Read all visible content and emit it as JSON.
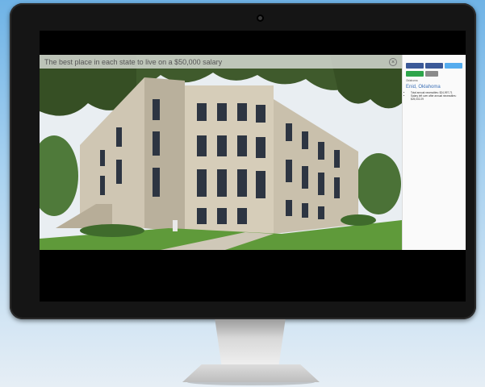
{
  "article": {
    "caption": "The best place in each state to live on a $50,000 salary",
    "close_symbol": "×"
  },
  "sidebar": {
    "share_buttons": [
      {
        "name": "share",
        "color": "#3b5998"
      },
      {
        "name": "share",
        "color": "#3b5998"
      },
      {
        "name": "share",
        "color": "#55acee"
      },
      {
        "name": "share",
        "color": "#2ea54b"
      },
      {
        "name": "share",
        "color": "#8a8a8a"
      }
    ],
    "section_label": "Oklahoma",
    "byline": "",
    "place": "Enid, Oklahoma",
    "bullets": [
      "Total annual necessities: $24,997.71",
      "Salary left over after annual necessities: $25,002.29"
    ],
    "body": ""
  },
  "colors": {
    "accent": "#3b6fb6",
    "screen_bg": "#000000",
    "bezel": "#151515"
  }
}
